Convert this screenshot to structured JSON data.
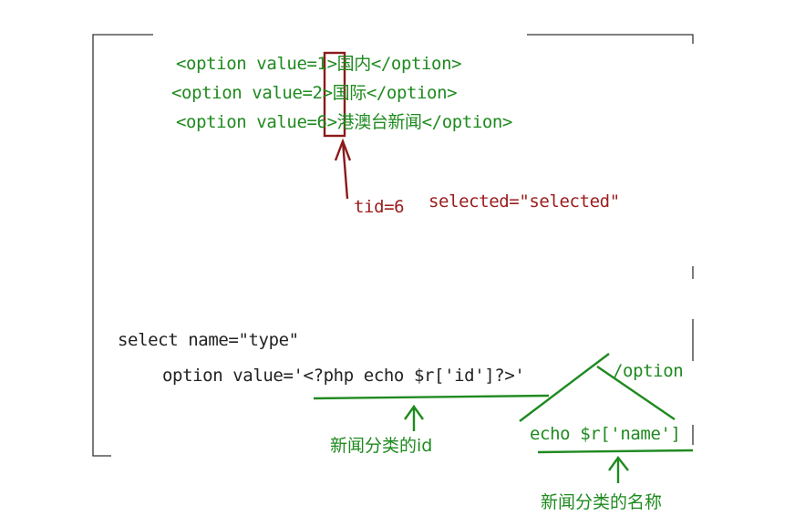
{
  "options_block": {
    "line1": "<option value=1>国内</option>",
    "line2": "<option value=2>国际</option>",
    "line3": "<option value=6>港澳台新闻</option>"
  },
  "annotations": {
    "tid": "tid=6",
    "selected": "selected=\"selected\"",
    "news_category_id": "新闻分类的id",
    "news_category_name": "新闻分类的名称"
  },
  "code": {
    "select_line": "select name=\"type\"",
    "option_line": "option value='<?php echo $r['id']?>'",
    "option_close": "/option",
    "echo_name": "echo $r['name']"
  },
  "colors": {
    "green": "#1f8a1f",
    "red_box": "#8b1a1a",
    "text_dark": "#222222",
    "frame": "#333333"
  }
}
